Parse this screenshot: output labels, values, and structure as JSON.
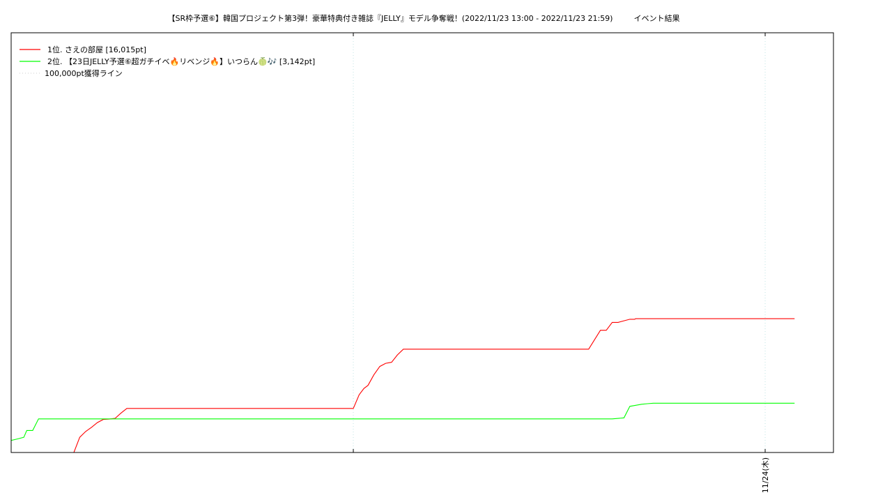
{
  "title": "【SR枠予選⑥】韓国プロジェクト第3弾！豪華特典付き雑誌『JELLY』モデル争奪戦！(2022/11/23 13:00 - 2022/11/23 21:59)",
  "subtitle": "イベント結果",
  "chart_data": {
    "type": "line",
    "x_range_hours_from_start": [
      0,
      12
    ],
    "y_range": [
      0,
      40000
    ],
    "grid": "vertical dotted",
    "legend_placement": "top-left",
    "x_ticks": [
      {
        "label": "",
        "hour": 6
      },
      {
        "label": "11/24(木)",
        "hour": 13
      }
    ],
    "series": [
      {
        "name": "1位. さえの部屋 [16,015pt]",
        "color": "#ff0000",
        "points": [
          [
            0,
            0
          ],
          [
            1.25,
            0
          ],
          [
            1.35,
            1450
          ],
          [
            1.45,
            2000
          ],
          [
            1.55,
            2400
          ],
          [
            1.65,
            2850
          ],
          [
            1.75,
            3150
          ],
          [
            1.85,
            3180
          ],
          [
            1.95,
            3250
          ],
          [
            2.05,
            3750
          ],
          [
            2.15,
            4200
          ],
          [
            6.0,
            4200
          ],
          [
            6.1,
            5500
          ],
          [
            6.18,
            6100
          ],
          [
            6.25,
            6400
          ],
          [
            6.35,
            7400
          ],
          [
            6.45,
            8200
          ],
          [
            6.55,
            8500
          ],
          [
            6.65,
            8600
          ],
          [
            6.75,
            9300
          ],
          [
            6.85,
            9850
          ],
          [
            10.0,
            9850
          ],
          [
            10.2,
            11650
          ],
          [
            10.3,
            11650
          ],
          [
            10.4,
            12400
          ],
          [
            10.5,
            12400
          ],
          [
            10.7,
            12700
          ],
          [
            10.78,
            12700
          ],
          [
            10.8,
            12750
          ],
          [
            11.5,
            12750
          ],
          [
            13.5,
            12750
          ]
        ]
      },
      {
        "name": "2位. 【23日JELLY予選⑥超ガチイベ🔥リベンジ🔥】いつらん🍈🎶 [3,142pt]",
        "color": "#00ff00",
        "points": [
          [
            0,
            0
          ],
          [
            0.15,
            1100
          ],
          [
            0.3,
            1300
          ],
          [
            0.4,
            1450
          ],
          [
            0.45,
            2100
          ],
          [
            0.55,
            2100
          ],
          [
            0.65,
            3200
          ],
          [
            10.4,
            3200
          ],
          [
            10.6,
            3300
          ],
          [
            10.7,
            4400
          ],
          [
            10.8,
            4500
          ],
          [
            10.9,
            4600
          ],
          [
            11.0,
            4650
          ],
          [
            11.1,
            4700
          ],
          [
            13.5,
            4700
          ]
        ]
      },
      {
        "name": "100,000pt獲得ライン",
        "color": "#cccccc",
        "points": []
      }
    ]
  }
}
